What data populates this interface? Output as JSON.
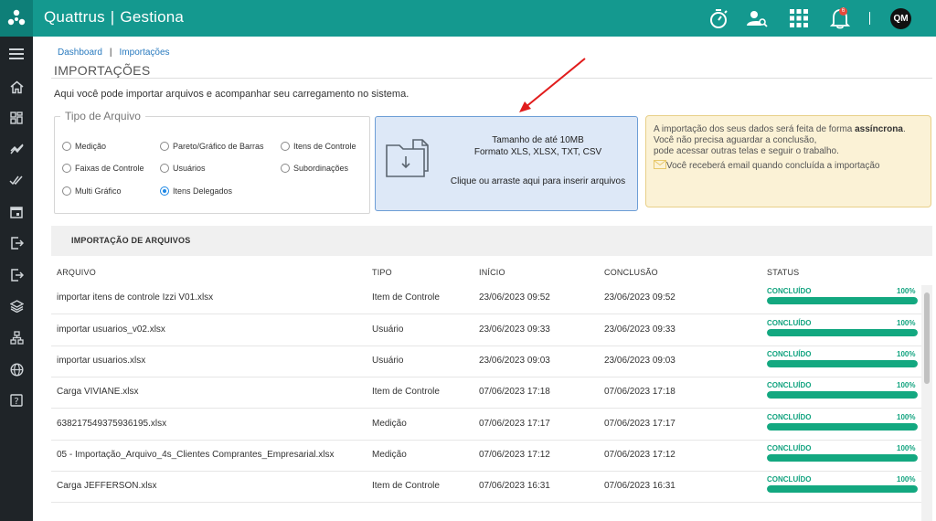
{
  "app": {
    "brand_name": "Quattrus",
    "brand_separator": "|",
    "product_name": "Gestiona",
    "notification_count": "6",
    "avatar_initials": "QM"
  },
  "colors": {
    "topbar": "#14998f",
    "sidebar": "#1f2428",
    "accent_blue": "#2a7bbf",
    "success": "#13a880",
    "dropzone_bg": "#dde8f7",
    "info_bg": "#fbf2d6"
  },
  "topbar_icons": [
    "stopwatch-icon",
    "user-search-icon",
    "apps-grid-icon",
    "bell-icon"
  ],
  "sidebar_icons": [
    "menu-icon",
    "home-icon",
    "dashboard-icon",
    "chart-line-icon",
    "check-double-icon",
    "calendar-icon",
    "login-icon",
    "export-icon",
    "layers-icon",
    "hierarchy-icon",
    "globe-icon",
    "help-icon"
  ],
  "breadcrumb": {
    "item1": "Dashboard",
    "separator": "|",
    "item2": "Importações"
  },
  "page": {
    "title": "IMPORTAÇÕES",
    "description": "Aqui você pode importar arquivos e acompanhar seu carregamento no sistema."
  },
  "file_type": {
    "legend": "Tipo de Arquivo",
    "options": [
      {
        "label": "Medição",
        "checked": false
      },
      {
        "label": "Pareto/Gráfico de Barras",
        "checked": false
      },
      {
        "label": "Itens de Controle",
        "checked": false
      },
      {
        "label": "Faixas de Controle",
        "checked": false
      },
      {
        "label": "Usuários",
        "checked": false
      },
      {
        "label": "Subordinações",
        "checked": false
      },
      {
        "label": "Multi Gráfico",
        "checked": false
      },
      {
        "label": "Itens Delegados",
        "checked": true
      }
    ]
  },
  "upload": {
    "size_text": "Tamanho de até 10MB",
    "format_text": "Formato XLS, XLSX, TXT, CSV",
    "action_text": "Clique ou arraste aqui para inserir arquivos"
  },
  "info": {
    "line1_prefix": "A importação dos seus dados será feita de forma ",
    "line1_bold": "assíncrona",
    "line1_suffix": ".",
    "line2": "Você não precisa aguardar a conclusão,",
    "line3": "pode acessar outras telas e seguir o trabalho.",
    "line4": "Você receberá email quando concluída a importação"
  },
  "table": {
    "section_title": "IMPORTAÇÃO DE ARQUIVOS",
    "headers": {
      "file": "ARQUIVO",
      "type": "TIPO",
      "start": "INÍCIO",
      "end": "CONCLUSÃO",
      "status": "STATUS"
    },
    "rows": [
      {
        "file": "importar itens de controle Izzi V01.xlsx",
        "type": "Item de Controle",
        "start": "23/06/2023 09:52",
        "end": "23/06/2023 09:52",
        "status": "CONCLUÍDO",
        "percent": "100%",
        "progress": 100
      },
      {
        "file": "importar usuarios_v02.xlsx",
        "type": "Usuário",
        "start": "23/06/2023 09:33",
        "end": "23/06/2023 09:33",
        "status": "CONCLUÍDO",
        "percent": "100%",
        "progress": 100
      },
      {
        "file": "importar usuarios.xlsx",
        "type": "Usuário",
        "start": "23/06/2023 09:03",
        "end": "23/06/2023 09:03",
        "status": "CONCLUÍDO",
        "percent": "100%",
        "progress": 100
      },
      {
        "file": "Carga VIVIANE.xlsx",
        "type": "Item de Controle",
        "start": "07/06/2023 17:18",
        "end": "07/06/2023 17:18",
        "status": "CONCLUÍDO",
        "percent": "100%",
        "progress": 100
      },
      {
        "file": "638217549375936195.xlsx",
        "type": "Medição",
        "start": "07/06/2023 17:17",
        "end": "07/06/2023 17:17",
        "status": "CONCLUÍDO",
        "percent": "100%",
        "progress": 100
      },
      {
        "file": "05 - Importação_Arquivo_4s_Clientes Comprantes_Empresarial.xlsx",
        "type": "Medição",
        "start": "07/06/2023 17:12",
        "end": "07/06/2023 17:12",
        "status": "CONCLUÍDO",
        "percent": "100%",
        "progress": 100
      },
      {
        "file": "Carga JEFFERSON.xlsx",
        "type": "Item de Controle",
        "start": "07/06/2023 16:31",
        "end": "07/06/2023 16:31",
        "status": "CONCLUÍDO",
        "percent": "100%",
        "progress": 100
      }
    ]
  }
}
